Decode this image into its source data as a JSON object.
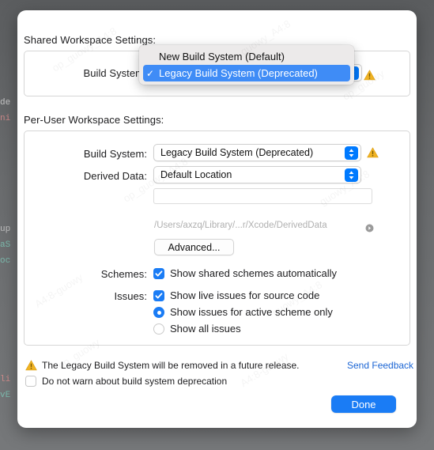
{
  "sheet": {
    "shared_section_label": "Shared Workspace Settings:",
    "peruser_section_label": "Per-User Workspace Settings:"
  },
  "shared": {
    "build_system_label": "Build System",
    "build_system_value": "Legacy Build System (Deprecated)",
    "warning_icon": "warning-triangle-icon"
  },
  "menu": {
    "items": [
      {
        "label": "New Build System (Default)",
        "checked": false
      },
      {
        "label": "Legacy Build System (Deprecated)",
        "checked": true
      }
    ],
    "check_glyph": "✓"
  },
  "peruser": {
    "build_system_label": "Build System:",
    "build_system_value": "Legacy Build System (Deprecated)",
    "derived_data_label": "Derived Data:",
    "derived_data_value": "Default Location",
    "custom_path_value": "",
    "custom_path_placeholder": "",
    "path_text": "/Users/axzq/Library/...r/Xcode/DerivedData",
    "path_reveal_icon": "reveal-arrow-icon",
    "advanced_button": "Advanced...",
    "schemes_label": "Schemes:",
    "schemes_option": "Show shared schemes automatically",
    "schemes_checked": true,
    "issues_label": "Issues:",
    "issues_live_option": "Show live issues for source code",
    "issues_live_checked": true,
    "issues_active_option": "Show issues for active scheme only",
    "issues_all_option": "Show all issues",
    "issues_radio_selected": "active"
  },
  "footer": {
    "warning_icon": "warning-triangle-icon",
    "warning_text": "The Legacy Build System will be removed in a future release.",
    "send_feedback": "Send Feedback",
    "do_not_warn_label": "Do not warn about build system deprecation",
    "do_not_warn_checked": false,
    "done_button": "Done"
  },
  "colors": {
    "accent_blue": "#1a7cf5",
    "menu_highlight": "#3f8cf6",
    "warning_yellow": "#f0b323",
    "link_blue": "#1b65d4"
  },
  "backdrop": {
    "code_fragments": [
      "de",
      "ni",
      "up",
      "aS",
      "oc",
      "li",
      "vE"
    ]
  },
  "watermarks": {
    "items": [
      "op_guowy_A4:8",
      "guowy_A4:8",
      "op_guowy",
      "A4:8-guowy",
      "guowy_A4:8"
    ]
  }
}
